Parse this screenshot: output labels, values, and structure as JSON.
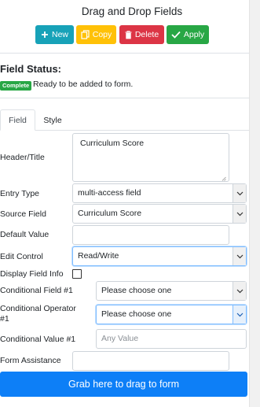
{
  "header": {
    "title": "Drag and Drop Fields"
  },
  "toolbar": {
    "new_label": "New",
    "copy_label": "Copy",
    "delete_label": "Delete",
    "apply_label": "Apply",
    "colors": {
      "new": "#17a2b8",
      "copy": "#ffc107",
      "delete": "#dc3545",
      "apply": "#28a745"
    }
  },
  "status": {
    "label": "Field Status:",
    "badge": "Complete",
    "badge_color": "#28a745",
    "message": "Ready to be added to form."
  },
  "tabs": [
    {
      "label": "Field",
      "active": true
    },
    {
      "label": "Style",
      "active": false
    }
  ],
  "form": {
    "header_title": {
      "label": "Header/Title",
      "value": "Curriculum Score"
    },
    "entry_type": {
      "label": "Entry Type",
      "value": "multi-access field"
    },
    "source_field": {
      "label": "Source Field",
      "value": "Curriculum Score"
    },
    "default_value": {
      "label": "Default Value",
      "value": ""
    },
    "edit_control": {
      "label": "Edit Control",
      "value": "Read/Write"
    },
    "display_field_info": {
      "label": "Display Field Info",
      "checked": false
    },
    "conditional_field_1": {
      "label": "Conditional Field #1",
      "value": "Please choose one"
    },
    "conditional_operator_1": {
      "label_line1": "Conditional Operator",
      "label_line2": "#1",
      "value": "Please choose one"
    },
    "conditional_value_1": {
      "label": "Conditional Value #1",
      "placeholder": "Any Value"
    },
    "form_assistance": {
      "label": "Form Assistance",
      "value": ""
    }
  },
  "drag_bar": {
    "label": "Grab here to drag to form",
    "color": "#0d7ff7"
  },
  "icons": [
    "plus-icon",
    "copy-icon",
    "trash-icon",
    "check-icon",
    "chevron-down-icon",
    "resize-grip-icon"
  ]
}
